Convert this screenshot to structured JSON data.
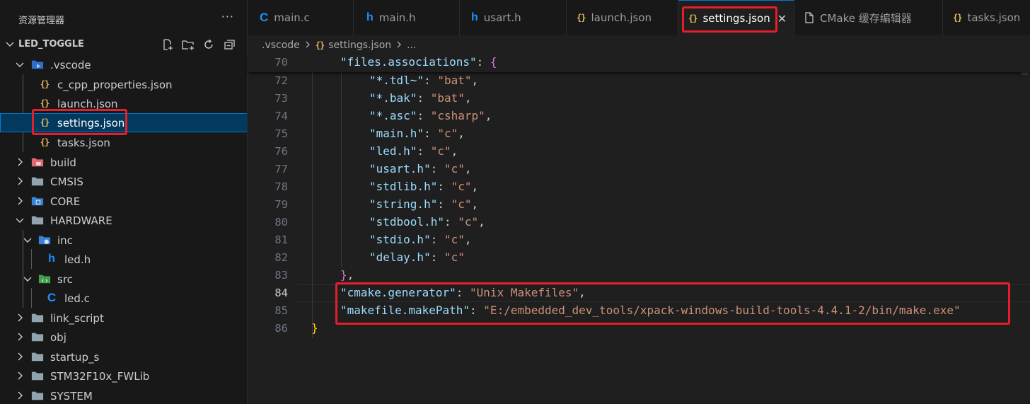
{
  "sidebar": {
    "title": "资源管理器",
    "more": "···",
    "project": "LED_TOGGLE",
    "actions": [
      "new-file-icon",
      "new-folder-icon",
      "refresh-icon",
      "collapse-all-icon"
    ],
    "tree": [
      {
        "label": ".vscode",
        "type": "folder-vscode",
        "depth": 1,
        "expanded": true
      },
      {
        "label": "c_cpp_properties.json",
        "type": "json",
        "depth": 2
      },
      {
        "label": "launch.json",
        "type": "json",
        "depth": 2
      },
      {
        "label": "settings.json",
        "type": "json",
        "depth": 2,
        "selected": true
      },
      {
        "label": "tasks.json",
        "type": "json",
        "depth": 2
      },
      {
        "label": "build",
        "type": "folder-build",
        "depth": 1,
        "expanded": false
      },
      {
        "label": "CMSIS",
        "type": "folder",
        "depth": 1,
        "expanded": false
      },
      {
        "label": "CORE",
        "type": "folder-core",
        "depth": 1,
        "expanded": false
      },
      {
        "label": "HARDWARE",
        "type": "folder",
        "depth": 1,
        "expanded": true
      },
      {
        "label": "inc",
        "type": "folder-inc",
        "depth": 2,
        "expanded": true
      },
      {
        "label": "led.h",
        "type": "h",
        "depth": 3
      },
      {
        "label": "src",
        "type": "folder-src",
        "depth": 2,
        "expanded": true
      },
      {
        "label": "led.c",
        "type": "c",
        "depth": 3
      },
      {
        "label": "link_script",
        "type": "folder",
        "depth": 1,
        "expanded": false
      },
      {
        "label": "obj",
        "type": "folder",
        "depth": 1,
        "expanded": false
      },
      {
        "label": "startup_s",
        "type": "folder",
        "depth": 1,
        "expanded": false
      },
      {
        "label": "STM32F10x_FWLib",
        "type": "folder",
        "depth": 1,
        "expanded": false
      },
      {
        "label": "SYSTEM",
        "type": "folder",
        "depth": 1,
        "expanded": false
      }
    ]
  },
  "tabs": [
    {
      "label": "main.c",
      "icon": "c"
    },
    {
      "label": "main.h",
      "icon": "h"
    },
    {
      "label": "usart.h",
      "icon": "h"
    },
    {
      "label": "launch.json",
      "icon": "json"
    },
    {
      "label": "settings.json",
      "icon": "json",
      "active": true,
      "close": "✕"
    },
    {
      "label": "CMake 缓存编辑器",
      "icon": "file"
    },
    {
      "label": "tasks.json",
      "icon": "json"
    }
  ],
  "breadcrumb": {
    "folder": ".vscode",
    "file": "settings.json",
    "more": "..."
  },
  "editor": {
    "sticky_line": {
      "num": "70",
      "key": "\"files.associations\"",
      "punct": ": ",
      "brace": "{"
    },
    "lines": [
      {
        "num": "72",
        "key": "\"*.tdl~\"",
        "value": "\"bat\"",
        "end": ","
      },
      {
        "num": "73",
        "key": "\"*.bak\"",
        "value": "\"bat\"",
        "end": ","
      },
      {
        "num": "74",
        "key": "\"*.asc\"",
        "value": "\"csharp\"",
        "end": ","
      },
      {
        "num": "75",
        "key": "\"main.h\"",
        "value": "\"c\"",
        "end": ","
      },
      {
        "num": "76",
        "key": "\"led.h\"",
        "value": "\"c\"",
        "end": ","
      },
      {
        "num": "77",
        "key": "\"usart.h\"",
        "value": "\"c\"",
        "end": ","
      },
      {
        "num": "78",
        "key": "\"stdlib.h\"",
        "value": "\"c\"",
        "end": ","
      },
      {
        "num": "79",
        "key": "\"string.h\"",
        "value": "\"c\"",
        "end": ","
      },
      {
        "num": "80",
        "key": "\"stdbool.h\"",
        "value": "\"c\"",
        "end": ","
      },
      {
        "num": "81",
        "key": "\"stdio.h\"",
        "value": "\"c\"",
        "end": ","
      },
      {
        "num": "82",
        "key": "\"delay.h\"",
        "value": "\"c\"",
        "end": ""
      }
    ],
    "line83": {
      "num": "83",
      "brace": "}",
      "end": ","
    },
    "line84": {
      "num": "84",
      "key": "\"cmake.generator\"",
      "value": "\"Unix Makefiles\"",
      "end": ","
    },
    "line85": {
      "num": "85",
      "key": "\"makefile.makePath\"",
      "value": "\"E:/embedded_dev_tools/xpack-windows-build-tools-4.4.1-2/bin/make.exe\"",
      "end": ""
    },
    "line86": {
      "num": "86",
      "brace": "}"
    },
    "colon": ": "
  },
  "colors": {
    "key": "#9cdcfe",
    "string": "#ce9178",
    "brace_outer": "#ffd700",
    "brace_inner": "#da70d6",
    "highlight": "#e41e2a",
    "accent": "#0078d4"
  }
}
